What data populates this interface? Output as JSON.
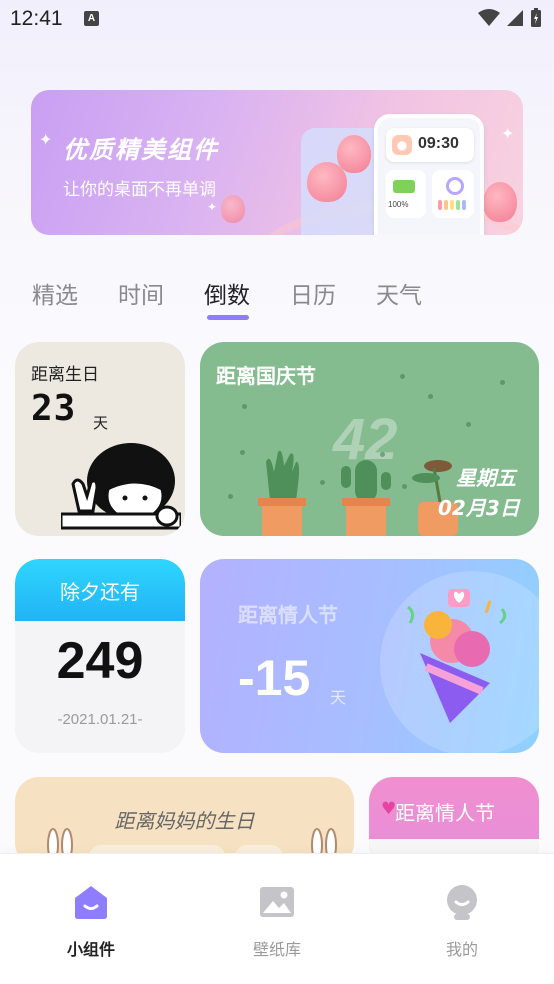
{
  "status": {
    "time": "12:41",
    "notif_icon": "A"
  },
  "banner": {
    "title": "优质精美组件",
    "subtitle": "让你的桌面不再单调",
    "clock": "09:30",
    "battery": "100%"
  },
  "tabs": [
    {
      "label": "精选",
      "active": false
    },
    {
      "label": "时间",
      "active": false
    },
    {
      "label": "倒数",
      "active": true
    },
    {
      "label": "日历",
      "active": false
    },
    {
      "label": "天气",
      "active": false
    }
  ],
  "cards": {
    "birthday": {
      "label": "距离生日",
      "days": "23",
      "unit": "天"
    },
    "national": {
      "label": "距离国庆节",
      "days": "42",
      "weekday": "星期五",
      "date": "02月3日"
    },
    "newyear": {
      "label": "除夕还有",
      "days": "249",
      "date": "-2021.01.21-"
    },
    "valentine": {
      "label": "距离情人节",
      "days": "-15",
      "unit": "天"
    },
    "mom": {
      "label": "距离妈妈的生日"
    },
    "valentine2": {
      "label": "距离情人节"
    }
  },
  "nav": [
    {
      "label": "小组件",
      "icon": "home-icon",
      "active": true
    },
    {
      "label": "壁纸库",
      "icon": "wallpaper-icon",
      "active": false
    },
    {
      "label": "我的",
      "icon": "profile-icon",
      "active": false
    }
  ],
  "colors": {
    "accent": "#8f7dff",
    "green_card": "#84bb8f",
    "cyan_header": "#22b3f6"
  }
}
